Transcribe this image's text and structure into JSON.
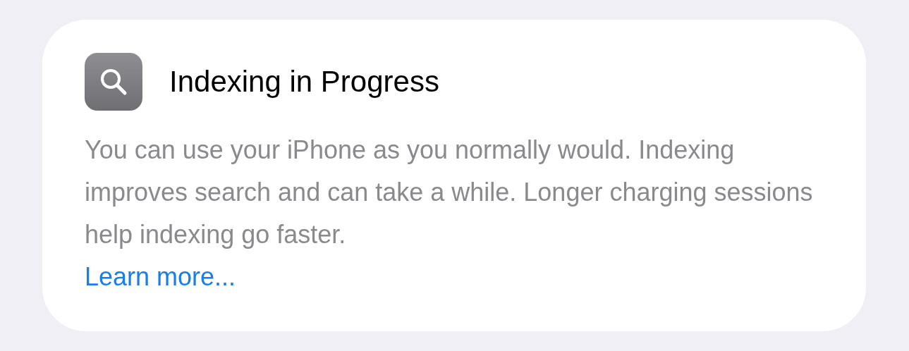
{
  "card": {
    "title": "Indexing in Progress",
    "body": "You can use your iPhone as you normally would. Indexing improves search and can take a while. Longer charging sessions help indexing go faster.",
    "link": "Learn more..."
  }
}
